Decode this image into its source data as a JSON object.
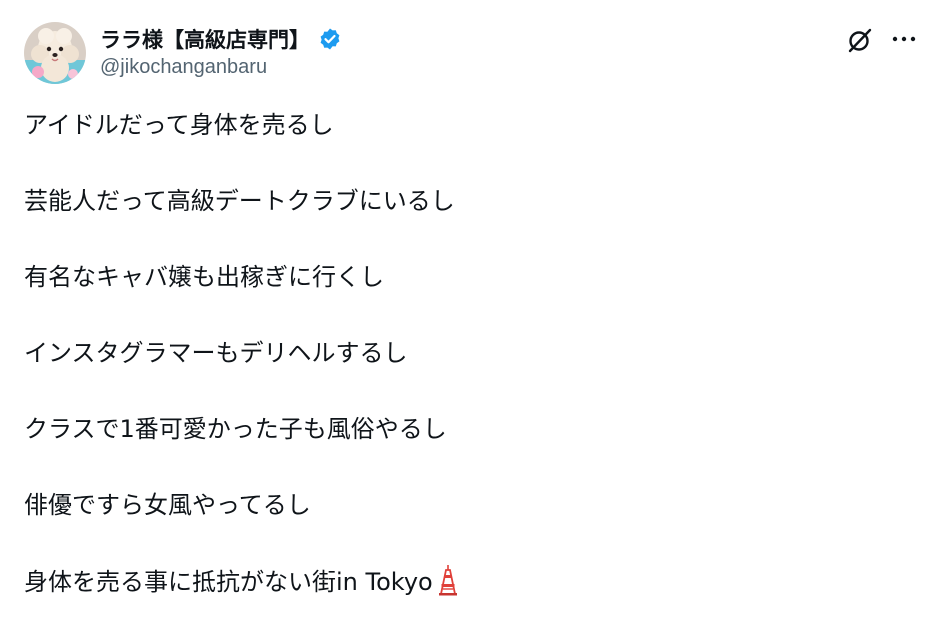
{
  "author": {
    "display_name": "ララ様【高級店専門】",
    "handle": "@jikochanganbaru",
    "verified": true,
    "verified_color": "#1d9bf0",
    "avatar_icon": "poodle-avatar"
  },
  "actions": {
    "grok_icon": "grok-icon",
    "more_icon": "more-icon"
  },
  "post": {
    "lines": [
      "アイドルだって身体を売るし",
      "芸能人だって高級デートクラブにいるし",
      "有名なキャバ嬢も出稼ぎに行くし",
      "インスタグラマーもデリヘルするし",
      "クラスで1番可愛かった子も風俗やるし",
      "俳優ですら女風やってるし",
      "身体を売る事に抵抗がない街in Tokyo"
    ],
    "last_line_emoji": "tokyo-tower-icon"
  },
  "colors": {
    "text": "#0f1419",
    "secondary": "#536471",
    "emoji_red": "#e0403a"
  }
}
